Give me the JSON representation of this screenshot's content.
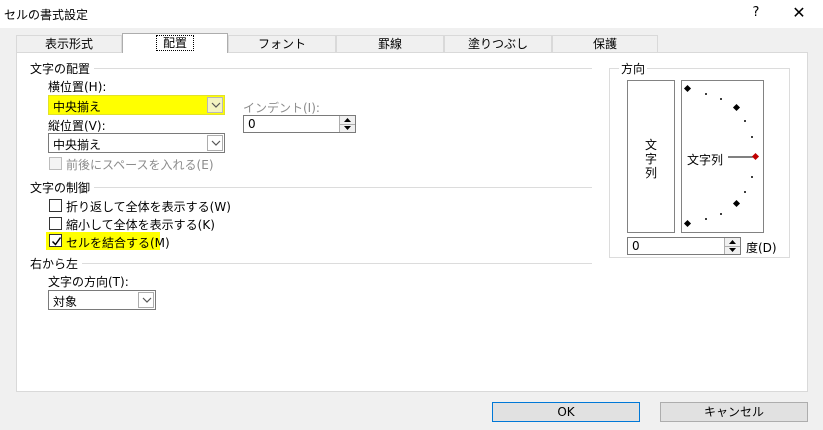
{
  "window": {
    "title": "セルの書式設定",
    "help": "?",
    "close": "✕"
  },
  "tabs": [
    {
      "label": "表示形式"
    },
    {
      "label": "配置"
    },
    {
      "label": "フォント"
    },
    {
      "label": "罫線"
    },
    {
      "label": "塗りつぶし"
    },
    {
      "label": "保護"
    }
  ],
  "alignment": {
    "group_title": "文字の配置",
    "horizontal": {
      "label": "横位置(H):",
      "value": "中央揃え"
    },
    "vertical": {
      "label": "縦位置(V):",
      "value": "中央揃え"
    },
    "indent": {
      "label": "インデント(I):",
      "value": "0"
    },
    "distributed": {
      "label": "前後にスペースを入れる(E)",
      "checked": false
    }
  },
  "text_control": {
    "group_title": "文字の制御",
    "wrap": {
      "label": "折り返して全体を表示する(W)",
      "checked": false
    },
    "shrink": {
      "label": "縮小して全体を表示する(K)",
      "checked": false
    },
    "merge": {
      "label": "セルを結合する(M)",
      "checked": true
    }
  },
  "rtl": {
    "group_title": "右から左",
    "direction": {
      "label": "文字の方向(T):",
      "value": "対象"
    }
  },
  "orientation": {
    "group_title": "方向",
    "vertical_text": "文字列",
    "dial_text": "文字列",
    "degrees": {
      "value": "0",
      "label": "度(D)"
    }
  },
  "buttons": {
    "ok": "OK",
    "cancel": "キャンセル"
  },
  "colors": {
    "highlight": "#ffff00",
    "dial_marker": "#c00000",
    "default_button_border": "#0078d7"
  }
}
